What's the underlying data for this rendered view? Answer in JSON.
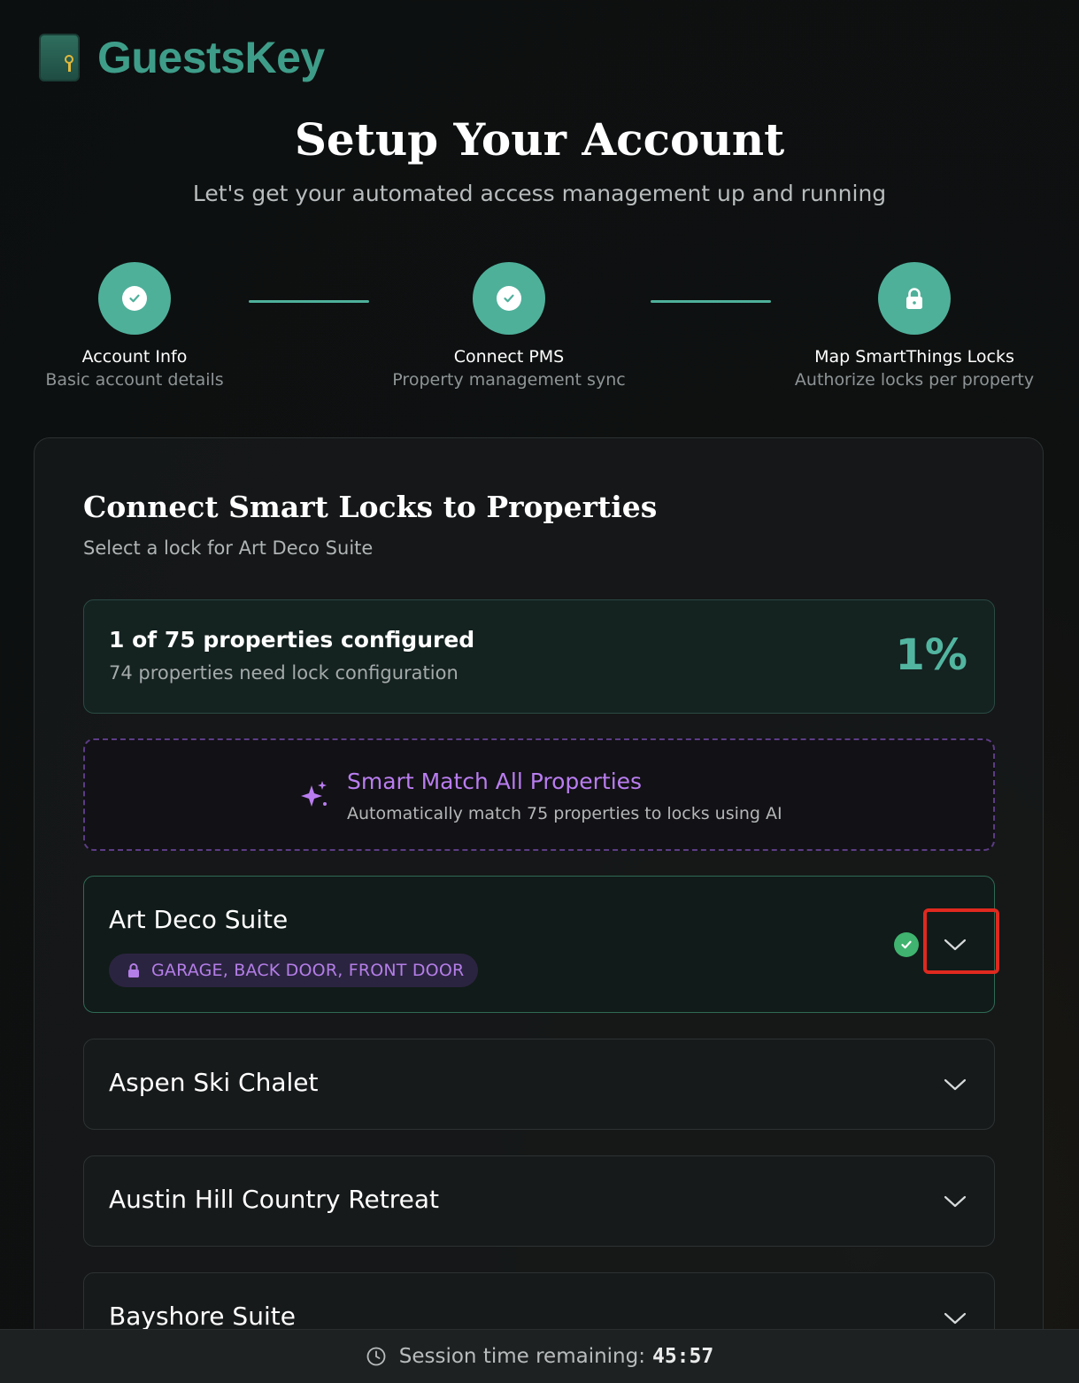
{
  "brand": {
    "name": "GuestsKey"
  },
  "header": {
    "title": "Setup Your Account",
    "subtitle": "Let's get your automated access management up and running"
  },
  "steps": [
    {
      "label": "Account Info",
      "description": "Basic account details",
      "state": "complete",
      "icon": "check-icon"
    },
    {
      "label": "Connect PMS",
      "description": "Property management sync",
      "state": "complete",
      "icon": "check-icon"
    },
    {
      "label": "Map SmartThings Locks",
      "description": "Authorize locks per property",
      "state": "current",
      "icon": "lock-icon"
    }
  ],
  "panel": {
    "title": "Connect Smart Locks to Properties",
    "subtitle": "Select a lock for Art Deco Suite"
  },
  "progress": {
    "summary": "1 of 75 properties configured",
    "detail": "74 properties need lock configuration",
    "percent_label": "1%"
  },
  "smart_match": {
    "title": "Smart Match All Properties",
    "description": "Automatically match 75 properties to locks using AI",
    "icon": "sparkle-icon"
  },
  "properties": [
    {
      "name": "Art Deco Suite",
      "locks": "GARAGE, BACK DOOR, FRONT DOOR",
      "configured": true
    },
    {
      "name": "Aspen Ski Chalet"
    },
    {
      "name": "Austin Hill Country Retreat"
    },
    {
      "name": "Bayshore Suite"
    }
  ],
  "footer": {
    "label": "Session time remaining:",
    "time": "45:57",
    "icon": "clock-icon"
  },
  "colors": {
    "accent": "#4fb09a",
    "purple": "#b97df0",
    "success": "#3fb36f",
    "highlight": "#e0291f"
  }
}
